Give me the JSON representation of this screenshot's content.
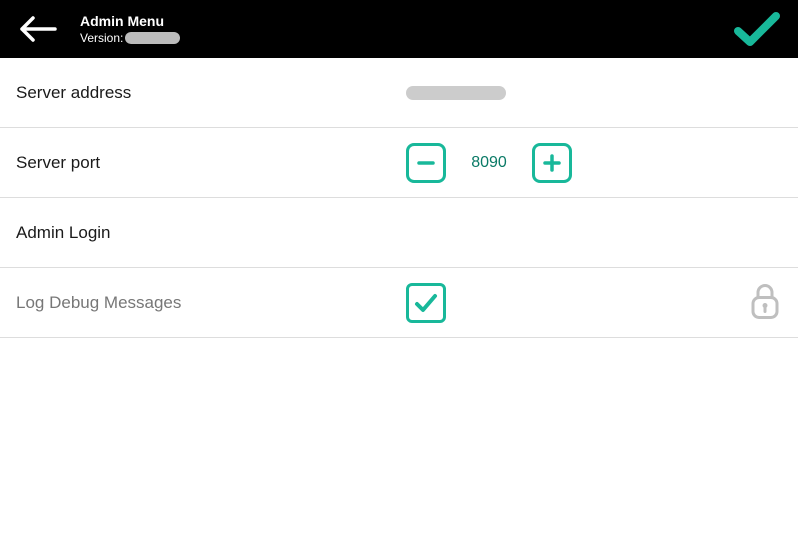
{
  "header": {
    "title": "Admin Menu",
    "version_label": "Version:"
  },
  "rows": {
    "server_address": {
      "label": "Server address"
    },
    "server_port": {
      "label": "Server port",
      "value": "8090"
    },
    "admin_login": {
      "label": "Admin Login"
    },
    "log_debug": {
      "label": "Log Debug Messages",
      "checked": true,
      "locked": true
    }
  },
  "colors": {
    "accent": "#18b89a"
  }
}
